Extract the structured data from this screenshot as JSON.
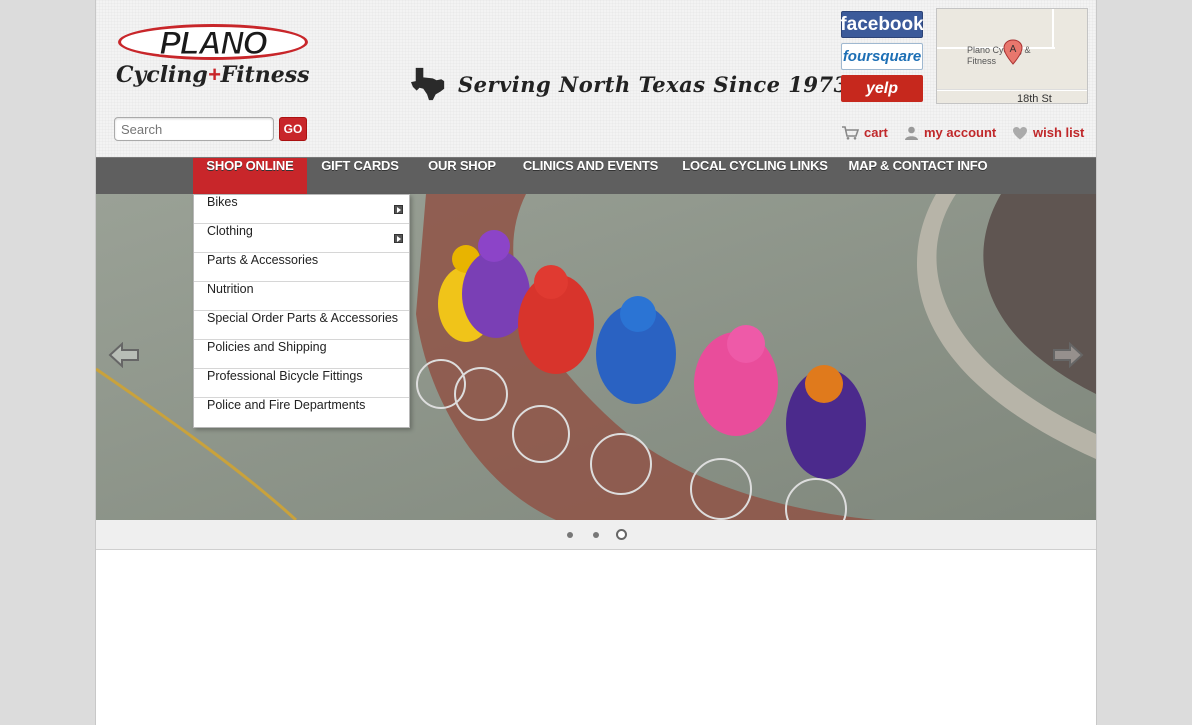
{
  "logo": {
    "top": "PLANO",
    "bottom_1": "Cycling",
    "plus": "+",
    "bottom_2": "Fitness"
  },
  "tagline": "Serving North Texas Since 1973",
  "social": {
    "facebook": "facebook",
    "foursquare": "foursquare",
    "yelp": "yelp"
  },
  "map": {
    "label": "Plano Cycling & Fitness",
    "street": "18th St",
    "pin_letter": "A"
  },
  "search": {
    "placeholder": "Search",
    "go_label": "GO"
  },
  "account": {
    "cart": "cart",
    "my_account": "my account",
    "wish_list": "wish list"
  },
  "nav": {
    "items": [
      {
        "label": "SHOP ONLINE",
        "active": true
      },
      {
        "label": "GIFT CARDS"
      },
      {
        "label": "OUR SHOP"
      },
      {
        "label": "CLINICS AND EVENTS"
      },
      {
        "label": "LOCAL CYCLING LINKS"
      },
      {
        "label": "MAP & CONTACT INFO"
      }
    ]
  },
  "dropdown": {
    "items": [
      {
        "label": "Bikes",
        "has_submenu": true
      },
      {
        "label": "Clothing",
        "has_submenu": true
      },
      {
        "label": "Parts & Accessories"
      },
      {
        "label": "Nutrition"
      },
      {
        "label": "Special Order Parts & Accessories"
      },
      {
        "label": "Policies and Shipping"
      },
      {
        "label": "Professional Bicycle Fittings"
      },
      {
        "label": "Police and Fire Departments"
      }
    ]
  },
  "slider": {
    "slide_count": 3,
    "active_slide": 3
  },
  "colors": {
    "brand_red": "#c8262a",
    "nav_gray": "#5f5f5f",
    "facebook": "#3b5a9a",
    "yelp": "#c6281d"
  }
}
